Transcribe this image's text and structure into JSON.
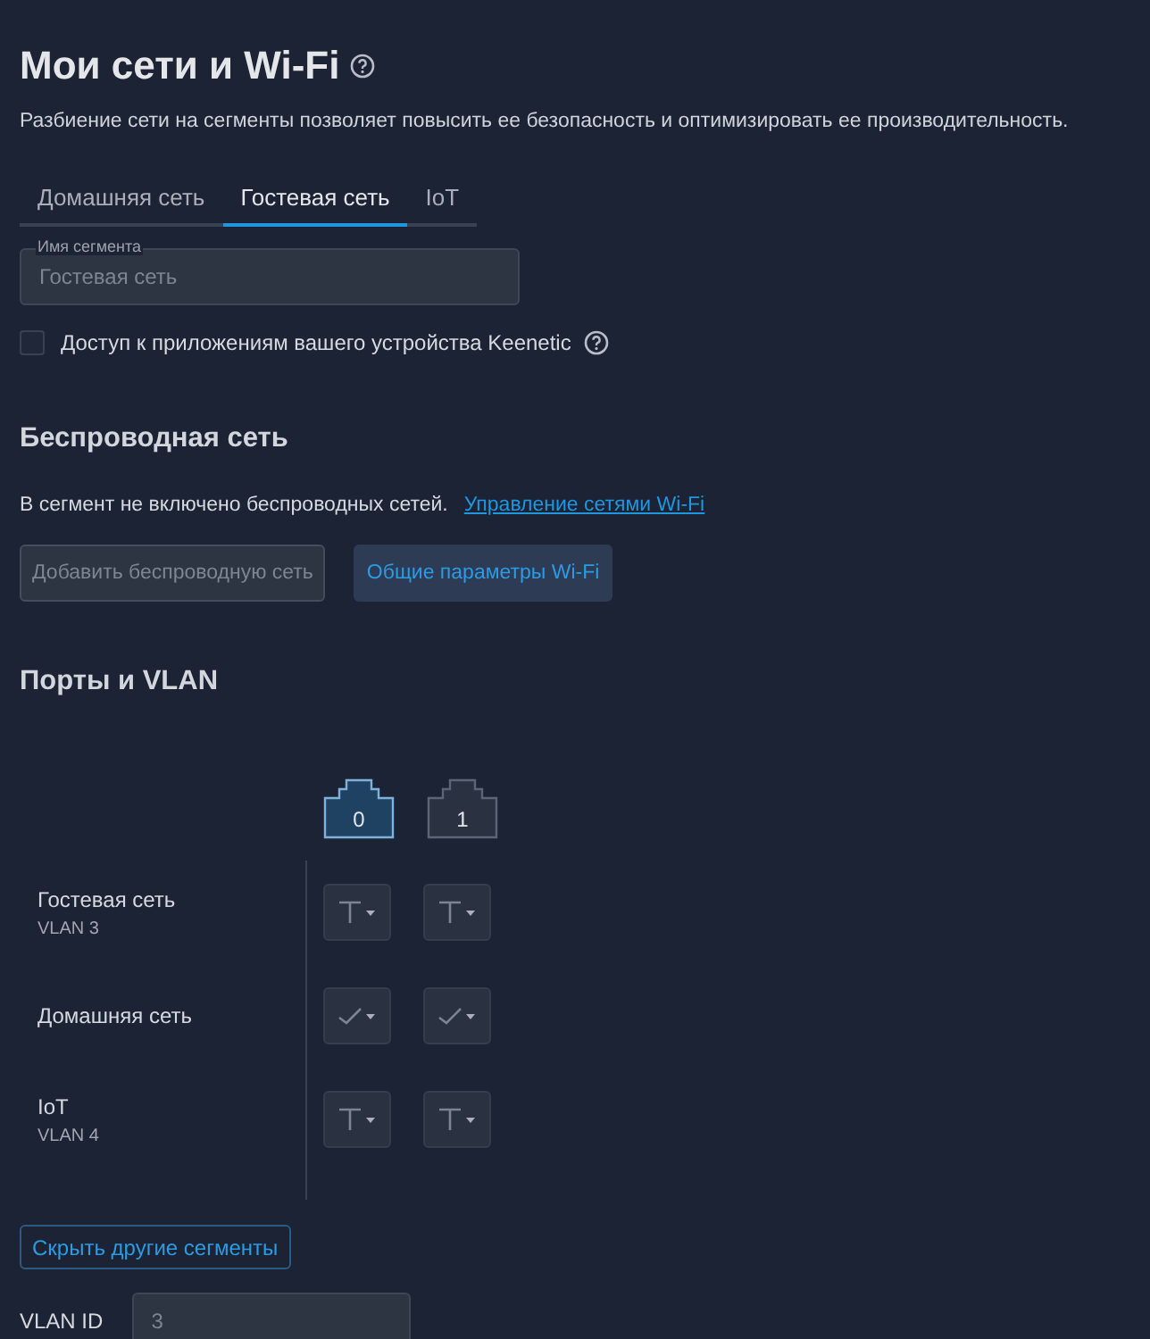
{
  "title": "Мои сети и Wi-Fi",
  "description": "Разбиение сети на сегменты позволяет повысить ее безопасность и оптимизировать ее производительность.",
  "tabs": [
    {
      "label": "Домашняя сеть",
      "selected": false
    },
    {
      "label": "Гостевая сеть",
      "selected": true
    },
    {
      "label": "IoT",
      "selected": false
    }
  ],
  "segment_name": {
    "label": "Имя сегмента",
    "value": "Гостевая сеть"
  },
  "app_access": {
    "label": "Доступ к приложениям вашего устройства Keenetic",
    "checked": false
  },
  "wireless": {
    "heading": "Беспроводная сеть",
    "note": "В сегмент не включено беспроводных сетей.",
    "link": "Управление сетями Wi-Fi",
    "buttons": [
      {
        "label": "Добавить беспроводную сеть",
        "disabled": true
      },
      {
        "label": "Общие параметры Wi-Fi",
        "disabled": false
      }
    ]
  },
  "ports": {
    "heading": "Порты и VLAN",
    "ports": [
      {
        "label": "0",
        "selected": true
      },
      {
        "label": "1",
        "selected": false
      }
    ],
    "segments": [
      {
        "name": "Гостевая сеть",
        "vlan": "VLAN 3",
        "modes": [
          {
            "kind": "tagged"
          },
          {
            "kind": "tagged"
          }
        ]
      },
      {
        "name": "Домашняя сеть",
        "modes": [
          {
            "kind": "untagged"
          },
          {
            "kind": "untagged"
          }
        ]
      },
      {
        "name": "IoT",
        "vlan": "VLAN 4",
        "modes": [
          {
            "kind": "tagged"
          },
          {
            "kind": "tagged"
          }
        ]
      }
    ],
    "toggle_button": "Скрыть другие сегменты"
  },
  "vlan_id": {
    "label": "VLAN ID",
    "value": "3"
  }
}
